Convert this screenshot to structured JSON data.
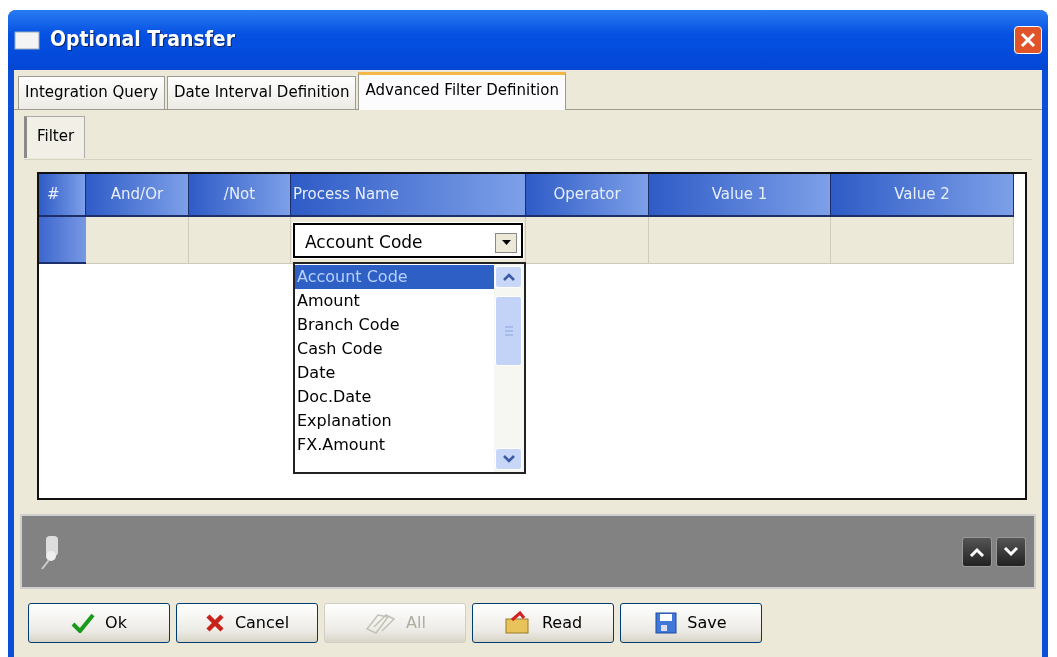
{
  "window": {
    "title": "Optional Transfer"
  },
  "tabs": [
    {
      "label": "Integration Query",
      "selected": false
    },
    {
      "label": "Date Interval Definition",
      "selected": false
    },
    {
      "label": "Advanced Filter Definition",
      "selected": true
    }
  ],
  "subtabs": [
    {
      "label": "Filter",
      "selected": true
    }
  ],
  "grid": {
    "columns": [
      "#",
      "And/Or",
      "/Not",
      "Process Name",
      "Operator",
      "Value 1",
      "Value 2"
    ],
    "row": {
      "process_name": {
        "value": "Account Code",
        "expanded": true,
        "options": [
          {
            "label": "Account Code",
            "selected": true
          },
          {
            "label": "Amount",
            "selected": false
          },
          {
            "label": "Branch Code",
            "selected": false
          },
          {
            "label": "Cash Code",
            "selected": false
          },
          {
            "label": "Date",
            "selected": false
          },
          {
            "label": "Doc.Date",
            "selected": false
          },
          {
            "label": "Explanation",
            "selected": false
          },
          {
            "label": "FX.Amount",
            "selected": false
          }
        ]
      }
    }
  },
  "buttons": [
    {
      "label": "Ok",
      "kind": "ok",
      "disabled": false
    },
    {
      "label": "Cancel",
      "kind": "cancel",
      "disabled": false
    },
    {
      "label": "All",
      "kind": "all",
      "disabled": true
    },
    {
      "label": "Read",
      "kind": "read",
      "disabled": false
    },
    {
      "label": "Save",
      "kind": "save",
      "disabled": false
    }
  ]
}
